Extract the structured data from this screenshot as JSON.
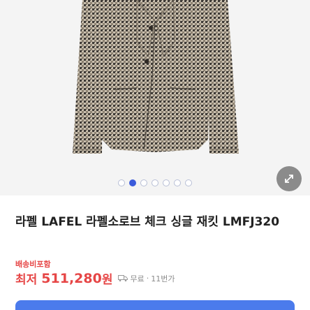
{
  "gallery": {
    "slide_count": 7,
    "active_index": 1
  },
  "product": {
    "title": "라펠 LAFEL 라펠소로브 체크 싱글 재킷 LMFJ320",
    "shipping_note": "배송비포함",
    "price_prefix": "최저",
    "price_value": "511,280",
    "price_unit": "원",
    "shipping_fee": "무료",
    "separator": "·",
    "seller": "11번가"
  },
  "colors": {
    "accent_red": "#e64646",
    "dot_active": "#3b5bdb",
    "cta_blue": "#4b7bec"
  },
  "icons": {
    "zoom": "expand-diagonal-icon",
    "shipping": "truck-icon"
  }
}
